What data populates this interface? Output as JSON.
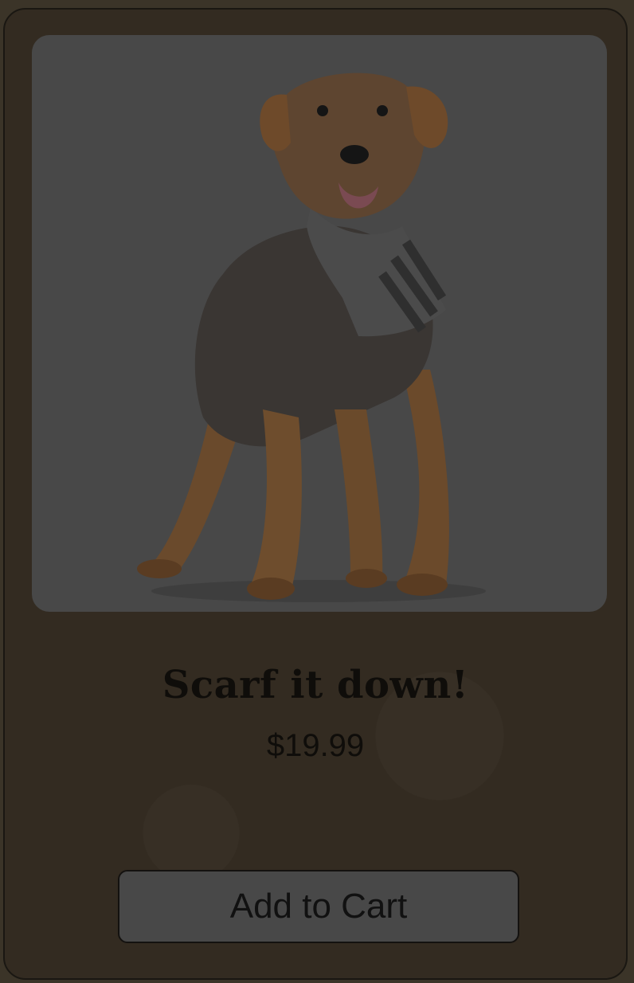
{
  "product": {
    "name": "Scarf it down!",
    "price": "$19.99",
    "image_subject": "terrier dog wearing striped scarf"
  },
  "actions": {
    "add_to_cart_label": "Add to Cart"
  },
  "colors": {
    "page_background": "#3b3428",
    "card_background": "#332b21",
    "photo_background": "#484848",
    "button_background": "#484848",
    "text": "#0f0d0a"
  }
}
